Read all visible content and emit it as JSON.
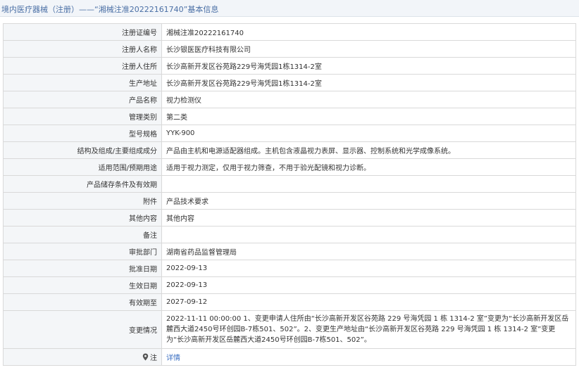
{
  "header": {
    "title": "境内医疗器械（注册）——“湘械注准20222161740”基本信息"
  },
  "rows": [
    {
      "label": "注册证编号",
      "value": "湘械注准20222161740"
    },
    {
      "label": "注册人名称",
      "value": "长沙银医医疗科技有限公司"
    },
    {
      "label": "注册人住所",
      "value": "长沙高新开发区谷苑路229号海凭园1栋1314-2室"
    },
    {
      "label": "生产地址",
      "value": "长沙高新开发区谷苑路229号海凭园1栋1314-2室"
    },
    {
      "label": "产品名称",
      "value": "视力检测仪"
    },
    {
      "label": "管理类别",
      "value": "第二类"
    },
    {
      "label": "型号规格",
      "value": "YYK-900"
    },
    {
      "label": "结构及组成/主要组成成分",
      "value": "产品由主机和电源适配器组成。主机包含液晶视力表屏、显示器、控制系统和光学成像系统。"
    },
    {
      "label": "适用范围/预期用途",
      "value": "适用于视力测定，仅用于视力筛查，不用于验光配镜和视力诊断。"
    },
    {
      "label": "产品储存条件及有效期",
      "value": ""
    },
    {
      "label": "附件",
      "value": "产品技术要求"
    },
    {
      "label": "其他内容",
      "value": "其他内容"
    },
    {
      "label": "备注",
      "value": ""
    },
    {
      "label": "审批部门",
      "value": "湖南省药品监督管理局"
    },
    {
      "label": "批准日期",
      "value": "2022-09-13"
    },
    {
      "label": "生效日期",
      "value": "2022-09-13"
    },
    {
      "label": "有效期至",
      "value": "2027-09-12"
    },
    {
      "label": "变更情况",
      "value": "2022-11-11 00:00:00 1、变更申请人住所由“长沙高新开发区谷苑路 229 号海凭园 1 栋 1314-2 室”变更为“长沙高新开发区岳麓西大道2450号环创园B-7栋501、502”。2、变更生产地址由“长沙高新开发区谷苑路 229 号海凭园 1 栋 1314-2 室”变更为“长沙高新开发区岳麓西大道2450号环创园B-7栋501、502”。"
    }
  ],
  "note": {
    "label": "注",
    "link": "详情",
    "icon": "map-pin-icon"
  }
}
